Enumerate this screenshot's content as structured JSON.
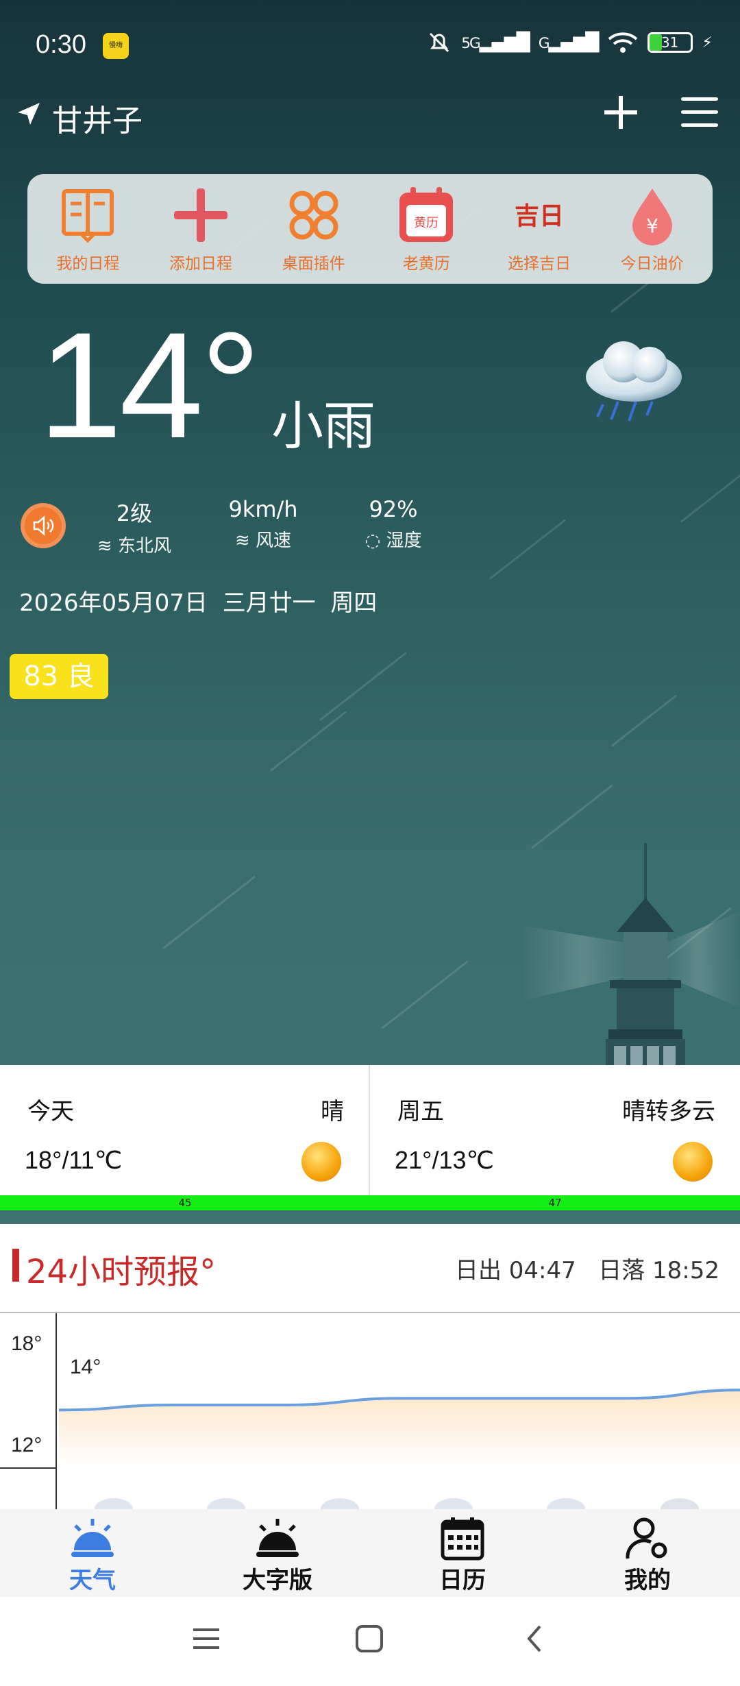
{
  "status_bar": {
    "time": "0:30",
    "app_icon_text": "慢嗨",
    "network_1": "5G",
    "network_2": "G",
    "battery": "31"
  },
  "header": {
    "location": "甘井子"
  },
  "shortcuts": [
    {
      "label": "我的日程",
      "icon": "book-icon"
    },
    {
      "label": "添加日程",
      "icon": "plus-icon"
    },
    {
      "label": "桌面插件",
      "icon": "widgets-icon"
    },
    {
      "label": "老黄历",
      "icon": "almanac-icon",
      "inner": "黄历"
    },
    {
      "label": "选择吉日",
      "icon": "lucky-day-icon",
      "inner": "吉日"
    },
    {
      "label": "今日油价",
      "icon": "oil-drop-icon",
      "inner": "¥"
    }
  ],
  "current": {
    "temperature": "14°",
    "condition": "小雨",
    "wind_level": "2级",
    "wind_dir": "东北风",
    "wind_speed": "9km/h",
    "wind_speed_label": "风速",
    "humidity": "92%",
    "humidity_label": "湿度",
    "date": "2026年05月07日",
    "lunar": "三月廿一",
    "weekday": "周四",
    "aqi": "83 良"
  },
  "days": [
    {
      "name": "今天",
      "condition": "晴",
      "temp": "18°/11℃",
      "aqi": "45"
    },
    {
      "name": "周五",
      "condition": "晴转多云",
      "temp": "21°/13℃",
      "aqi": "47"
    }
  ],
  "forecast": {
    "title": "24小时预报°",
    "sunrise": "日出 04:47",
    "sunset": "日落 18:52"
  },
  "chart_data": {
    "type": "line",
    "y_ticks": [
      "18°",
      "12°"
    ],
    "ylim": [
      12,
      18
    ],
    "first_label": "14°",
    "values": [
      14,
      14.3,
      14.3,
      14.7,
      14.7,
      14.7,
      15.2
    ]
  },
  "bottom_nav": [
    {
      "label": "天气",
      "icon": "weather-icon",
      "active": true
    },
    {
      "label": "大字版",
      "icon": "sunrise-icon",
      "active": false
    },
    {
      "label": "日历",
      "icon": "calendar-icon",
      "active": false
    },
    {
      "label": "我的",
      "icon": "profile-icon",
      "active": false
    }
  ],
  "colors": {
    "accent": "#e8702c",
    "title_red": "#c82a2a",
    "active_blue": "#3b7de0",
    "aqi_yellow": "#f9e11c",
    "aqi_green": "#14ee14"
  }
}
